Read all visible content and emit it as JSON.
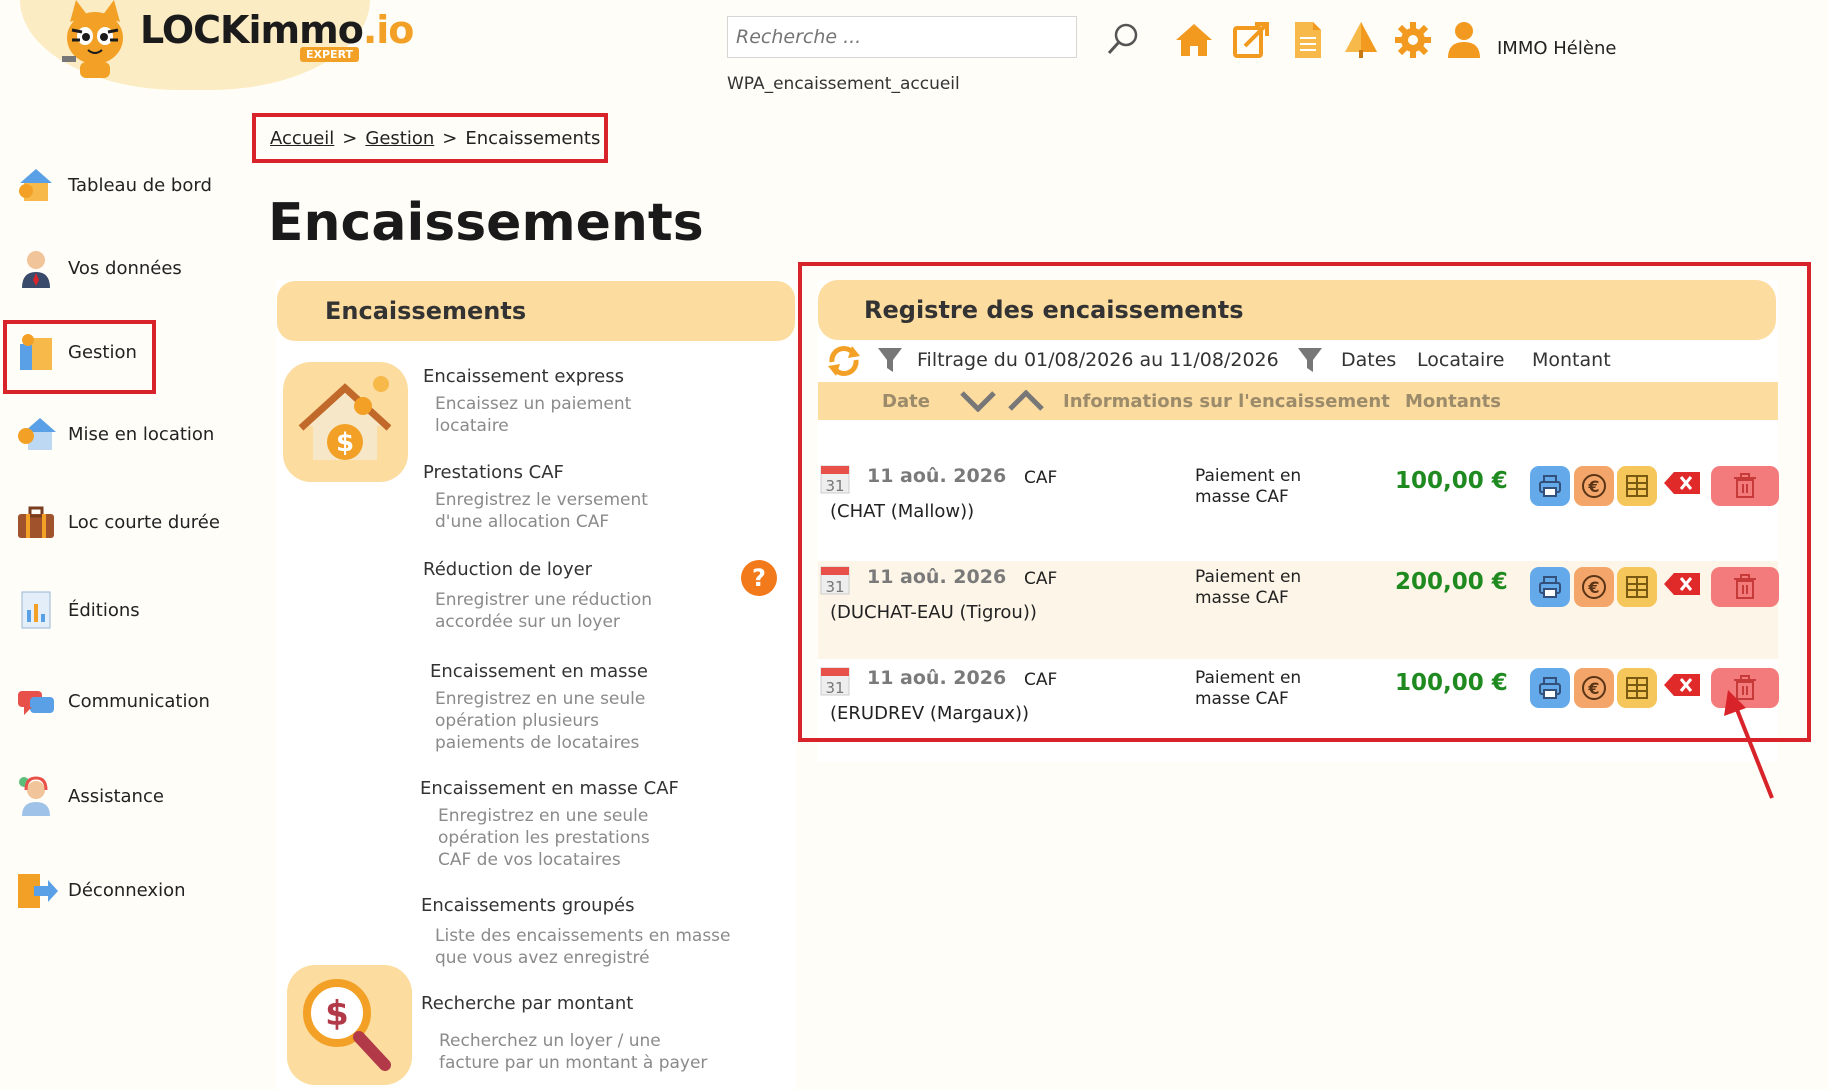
{
  "logo": {
    "main": "LOCKimmo",
    "suffix": ".io",
    "badge": "EXPERT"
  },
  "header": {
    "search_placeholder": "Recherche ...",
    "page_code": "WPA_encaissement_accueil",
    "user_name": "IMMO Hélène",
    "icons": [
      "home-icon",
      "external-link-icon",
      "document-icon",
      "tree-icon",
      "gear-icon",
      "user-icon"
    ]
  },
  "breadcrumb": {
    "home": "Accueil",
    "sep": ">",
    "section": "Gestion",
    "current": "Encaissements"
  },
  "page_title": "Encaissements",
  "sidebar": {
    "items": [
      {
        "label": "Tableau de bord",
        "icon": "dashboard-icon"
      },
      {
        "label": "Vos données",
        "icon": "person-icon"
      },
      {
        "label": "Gestion",
        "icon": "management-icon"
      },
      {
        "label": "Mise en location",
        "icon": "rental-icon"
      },
      {
        "label": "Loc courte durée",
        "icon": "suitcase-icon"
      },
      {
        "label": "Éditions",
        "icon": "report-icon"
      },
      {
        "label": "Communication",
        "icon": "chat-icon"
      },
      {
        "label": "Assistance",
        "icon": "support-icon"
      },
      {
        "label": "Déconnexion",
        "icon": "logout-icon"
      }
    ]
  },
  "left_panel": {
    "title": "Encaissements",
    "options": [
      {
        "title": "Encaissement express",
        "desc1": "Encaissez un paiement",
        "desc2": "locataire"
      },
      {
        "title": "Prestations CAF",
        "desc1": "Enregistrez le versement",
        "desc2": "d'une allocation CAF"
      },
      {
        "title": "Réduction de loyer",
        "desc1": "Enregistrer une réduction",
        "desc2": "accordée sur un loyer"
      },
      {
        "title": "Encaissement en masse",
        "desc1": "Enregistrez en une seule",
        "desc2": "opération plusieurs",
        "desc3": "paiements de locataires"
      },
      {
        "title": "Encaissement en masse CAF",
        "desc1": "Enregistrez en une seule",
        "desc2": "opération les prestations",
        "desc3": "CAF de vos locataires"
      },
      {
        "title": "Encaissements groupés",
        "desc1": "Liste des encaissements en masse",
        "desc2": "que vous avez enregistré"
      },
      {
        "title": "Recherche par montant",
        "desc1": "Recherchez un loyer / une",
        "desc2": "facture par un montant à payer"
      }
    ],
    "help": "?"
  },
  "register": {
    "title": "Registre des encaissements",
    "filter_text": "Filtrage du 01/08/2026 au 11/08/2026",
    "filters": [
      "Dates",
      "Locataire",
      "Montant"
    ],
    "columns": {
      "date": "Date",
      "info": "Informations sur l'encaissement",
      "amount": "Montants"
    },
    "rows": [
      {
        "day": "31",
        "date": "11 aoû. 2026",
        "source": "CAF",
        "tenant": "(CHAT (Mallow))",
        "info1": "Paiement en",
        "info2": "masse CAF",
        "amount": "100,00 €"
      },
      {
        "day": "31",
        "date": "11 aoû. 2026",
        "source": "CAF",
        "tenant": "(DUCHAT-EAU (Tigrou))",
        "info1": "Paiement en",
        "info2": "masse CAF",
        "amount": "200,00 €"
      },
      {
        "day": "31",
        "date": "11 aoû. 2026",
        "source": "CAF",
        "tenant": "(ERUDREV (Margaux))",
        "info1": "Paiement en",
        "info2": "masse CAF",
        "amount": "100,00 €"
      }
    ]
  }
}
